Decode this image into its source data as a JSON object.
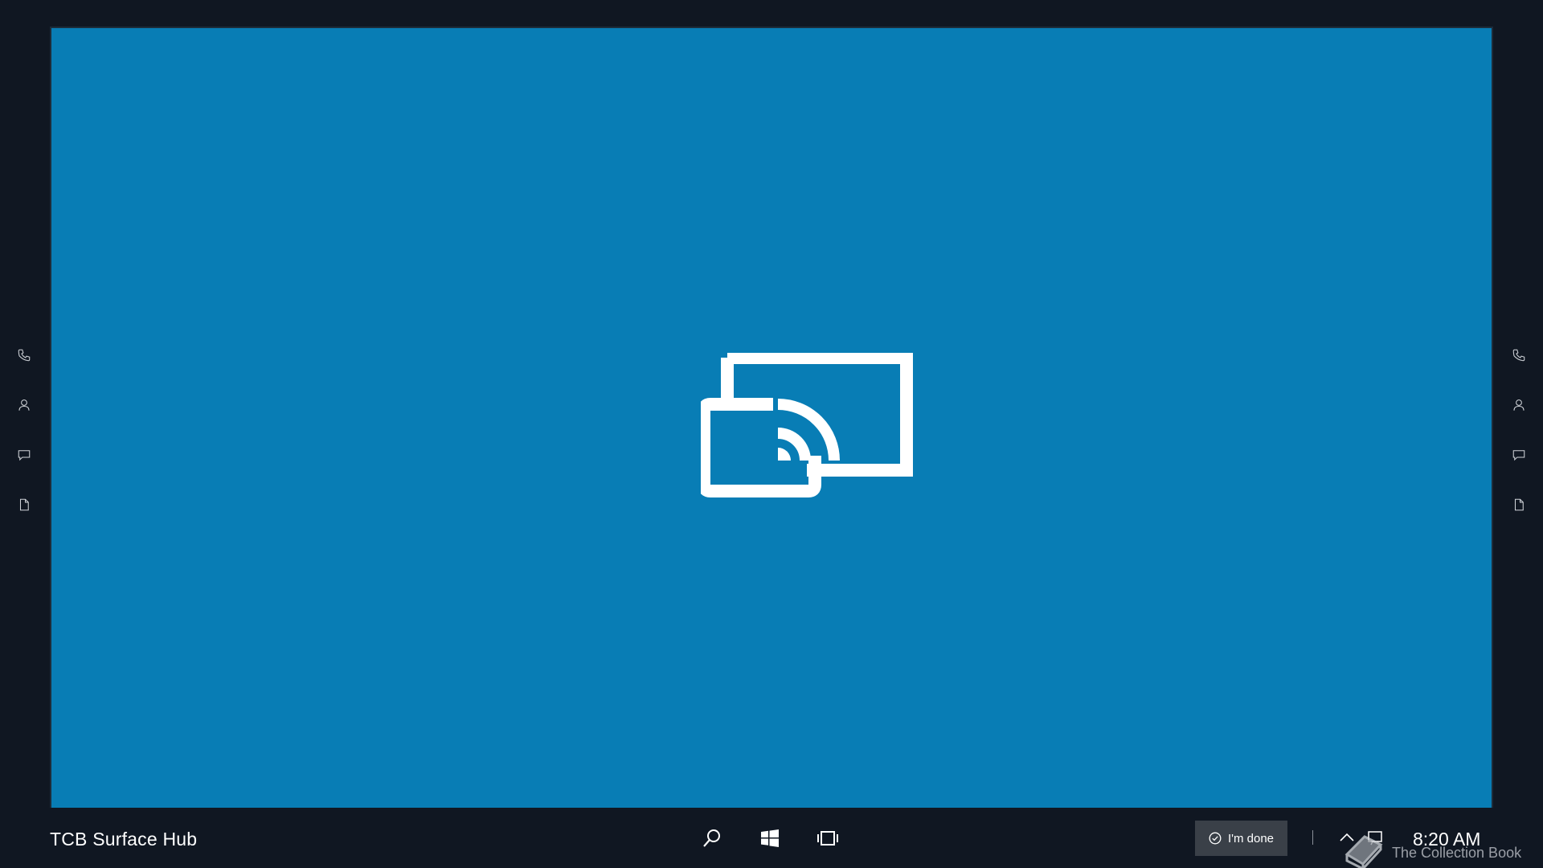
{
  "app": {
    "background_color": "#087db5",
    "center_icon": "screen-cast-icon"
  },
  "left_rail": [
    {
      "icon": "phone-icon"
    },
    {
      "icon": "person-icon"
    },
    {
      "icon": "chat-icon"
    },
    {
      "icon": "document-icon"
    }
  ],
  "right_rail": [
    {
      "icon": "phone-icon"
    },
    {
      "icon": "person-icon"
    },
    {
      "icon": "chat-icon"
    },
    {
      "icon": "document-icon"
    }
  ],
  "taskbar": {
    "device_name": "TCB Surface Hub",
    "search_icon": "search-icon",
    "start_icon": "windows-icon",
    "task_view_icon": "task-view-icon",
    "done_label": "I'm done",
    "clock": "8:20 AM"
  },
  "watermark": {
    "text": "The Collection Book"
  }
}
